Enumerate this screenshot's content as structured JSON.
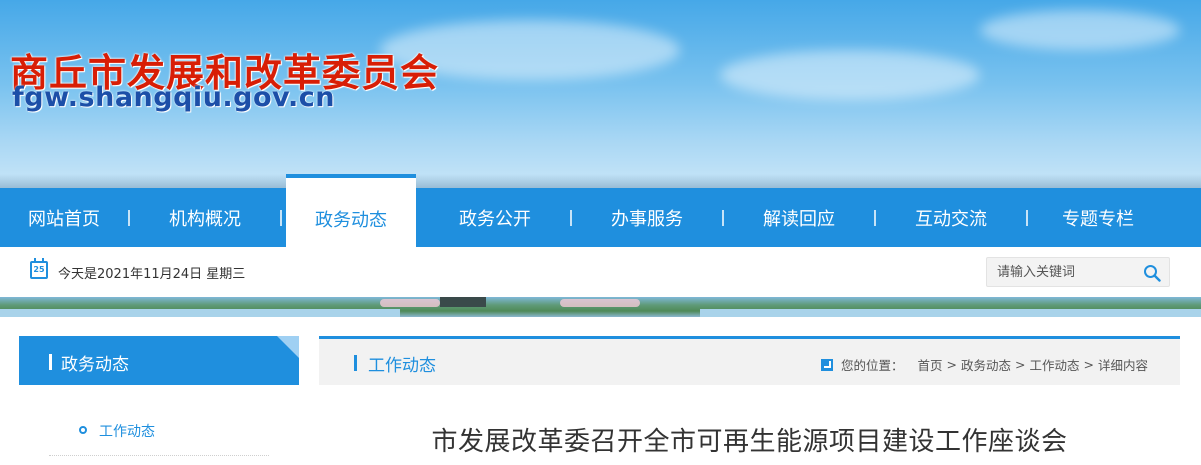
{
  "header": {
    "site_title": "商丘市发展和改革委员会",
    "site_url": "fgw.shangqiu.gov.cn"
  },
  "nav": {
    "items": [
      {
        "label": "网站首页"
      },
      {
        "label": "机构概况"
      },
      {
        "label": "政务动态",
        "active": true
      },
      {
        "label": "政务公开"
      },
      {
        "label": "办事服务"
      },
      {
        "label": "解读回应"
      },
      {
        "label": "互动交流"
      },
      {
        "label": "专题专栏"
      }
    ]
  },
  "infobar": {
    "calendar_day": "25",
    "calendar_icon": "calendar-icon",
    "today_text": "今天是2021年11月24日 星期三",
    "search": {
      "placeholder": "请输入关键词",
      "icon": "search-icon"
    }
  },
  "sidebar": {
    "heading": "政务动态",
    "items": [
      {
        "label": "工作动态"
      }
    ]
  },
  "main": {
    "section_title": "工作动态",
    "breadcrumb": {
      "prefix": "您的位置：",
      "items": [
        "首页",
        "政务动态",
        "工作动态",
        "详细内容"
      ],
      "separator": ">"
    },
    "article_title": "市发展改革委召开全市可再生能源项目建设工作座谈会"
  },
  "colors": {
    "primary": "#1f8fde",
    "title_red": "#d81e06",
    "url_blue": "#1c4fa8"
  }
}
